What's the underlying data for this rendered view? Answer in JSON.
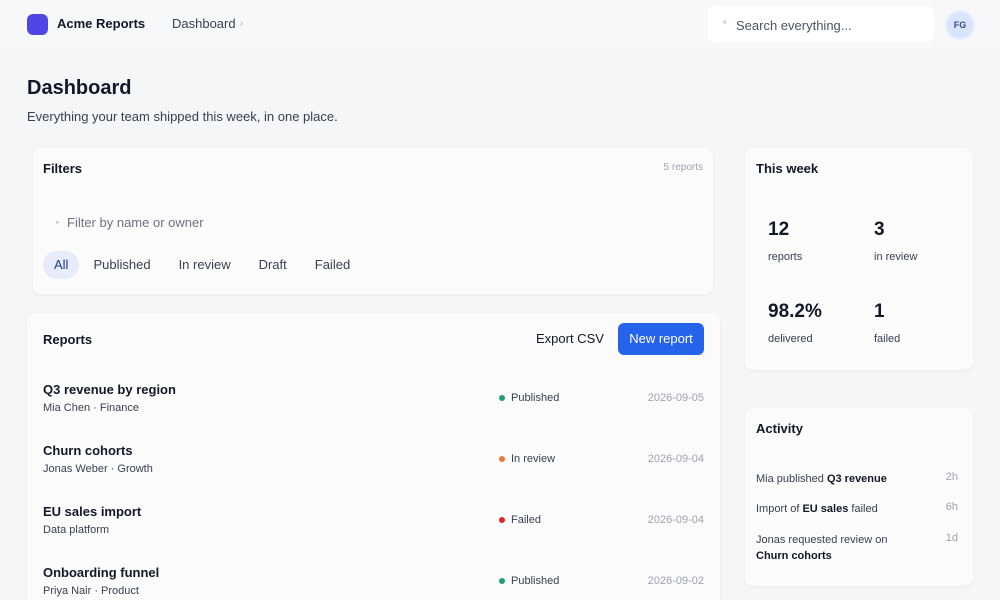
{
  "app": {
    "name": "Acme Reports",
    "breadcrumb": "Dashboard",
    "avatar_initials": "FG",
    "brand_color": "#4f46e5"
  },
  "search": {
    "placeholder": "Search everything..."
  },
  "page": {
    "title": "Dashboard",
    "subtitle": "Everything your team shipped this week, in one place."
  },
  "filters": {
    "title": "Filters",
    "count": "5 reports",
    "input_placeholder": "Filter by name or owner",
    "tabs": [
      {
        "label": "All",
        "active": true
      },
      {
        "label": "Published",
        "active": false
      },
      {
        "label": "In review",
        "active": false
      },
      {
        "label": "Draft",
        "active": false
      },
      {
        "label": "Failed",
        "active": false
      }
    ]
  },
  "reports": {
    "title": "Reports",
    "export_label": "Export CSV",
    "new_label": "New report",
    "rows": [
      {
        "name": "Q3 revenue by region",
        "meta": "Mia Chen · Finance",
        "status": "Published",
        "status_color": "#22a06b",
        "date": "2026-09-05"
      },
      {
        "name": "Churn cohorts",
        "meta": "Jonas Weber · Growth",
        "status": "In review",
        "status_color": "#ea7a3f",
        "date": "2026-09-04"
      },
      {
        "name": "EU sales import",
        "meta": "Data platform",
        "status": "Failed",
        "status_color": "#dc2626",
        "date": "2026-09-04"
      },
      {
        "name": "Onboarding funnel",
        "meta": "Priya Nair · Product",
        "status": "Published",
        "status_color": "#22a06b",
        "date": "2026-09-02"
      }
    ]
  },
  "week": {
    "title": "This week",
    "stats": [
      {
        "value": "12",
        "label": "reports"
      },
      {
        "value": "3",
        "label": "in review"
      },
      {
        "value": "98.2%",
        "label": "delivered"
      },
      {
        "value": "1",
        "label": "failed"
      }
    ]
  },
  "activity": {
    "title": "Activity",
    "items": [
      {
        "pre": "Mia published ",
        "bold": "Q3 revenue",
        "post": "",
        "time": "2h"
      },
      {
        "pre": "Import of ",
        "bold": "EU sales",
        "post": " failed",
        "time": "6h"
      },
      {
        "pre": "Jonas requested review on ",
        "bold": "Churn cohorts",
        "post": "",
        "time": "1d"
      }
    ]
  }
}
